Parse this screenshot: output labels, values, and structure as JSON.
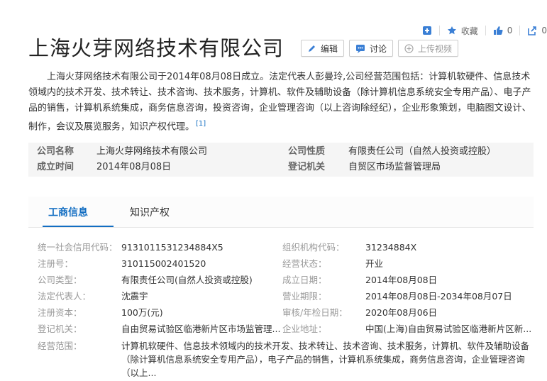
{
  "toolbar": {
    "favorite_label": "收藏",
    "like_count": "0",
    "share_count": "0"
  },
  "title": "上海火芽网络技术有限公司",
  "title_buttons": {
    "edit": "编辑",
    "discuss": "讨论",
    "upload_video": "上传视频"
  },
  "summary": {
    "text": "上海火芽网络技术有限公司于2014年08月08日成立。法定代表人彭曼玲,公司经营范围包括：计算机软硬件、信息技术领域内的技术开发、技术转让、技术咨询、技术服务，计算机、软件及辅助设备（除计算机信息系统安全专用产品）、电子产品的销售，计算机系统集成，商务信息咨询，投资咨询，企业管理咨询（以上咨询除经纪），企业形象策划，电脑图文设计、制作，会议及展览服务，知识产权代理。",
    "ref": "[1]"
  },
  "basic_info": {
    "company_name_label": "公司名称",
    "company_name": "上海火芽网络技术有限公司",
    "company_type_label": "公司性质",
    "company_type": "有限责任公司（自然人投资或控股）",
    "founded_label": "成立时间",
    "founded": "2014年08月08日",
    "authority_label": "登记机关",
    "authority": "自贸区市场监督管理局"
  },
  "tabs": [
    {
      "label": "工商信息"
    },
    {
      "label": "知识产权"
    }
  ],
  "details": {
    "credit_code_label": "统一社会信用代码：",
    "credit_code": "9131011531234884X5",
    "org_code_label": "组织机构代码：",
    "org_code": "31234884X",
    "reg_no_label": "注册号：",
    "reg_no": "310115002401520",
    "status_label": "经营状态：",
    "status": "开业",
    "type_label": "公司类型：",
    "type": "有限责任公司(自然人投资或控股)",
    "est_date_label": "成立日期：",
    "est_date": "2014年08月08日",
    "legal_rep_label": "法定代表人：",
    "legal_rep": "沈震宇",
    "term_label": "营业期限：",
    "term": "2014年08月08日-2034年08月07日",
    "capital_label": "注册资本：",
    "capital": "100万(元)",
    "check_date_label": "审核/年检日期：",
    "check_date": "2020年08月06日",
    "reg_authority_label": "登记机关：",
    "reg_authority": "自由贸易试验区临港新片区市场监管理...",
    "address_label": "企业地址：",
    "address": "中国(上海)自由贸易试验区临港新片区新...",
    "scope_label": "经营范围：",
    "scope": "计算机软硬件、信息技术领域内的技术开发、技术转让、技术咨询、技术服务，计算机、软件及辅助设备（除计算机信息系统安全专用产品），电子产品的销售，计算机系统集成，商务信息咨询，企业管理咨询（以上..."
  }
}
